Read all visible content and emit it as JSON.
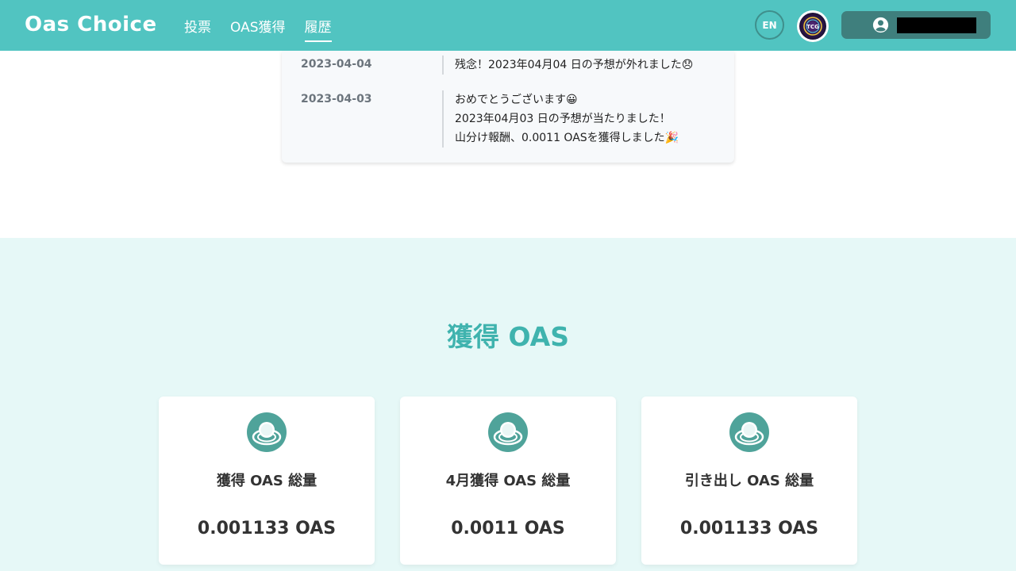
{
  "header": {
    "logo": "Oas Choice",
    "nav": [
      {
        "label": "投票"
      },
      {
        "label": "OAS獲得"
      },
      {
        "label": "履歴"
      }
    ],
    "lang": "EN",
    "avatar_text": "TCG"
  },
  "history": [
    {
      "date": "2023-04-04",
      "lines": [
        "残念！2023年04月04 日の予想が外れました😞"
      ]
    },
    {
      "date": "2023-04-03",
      "lines": [
        "おめでとうございます😀",
        "2023年04月03 日の予想が当たりました！",
        "山分け報酬、0.0011 OASを獲得しました🎉"
      ]
    }
  ],
  "earn": {
    "title": "獲得 OAS",
    "cards": [
      {
        "label": "獲得 OAS 総量",
        "value": "0.001133 OAS"
      },
      {
        "label": "4月獲得 OAS 総量",
        "value": "0.0011 OAS"
      },
      {
        "label": "引き出し OAS 総量",
        "value": "0.001133 OAS"
      }
    ]
  },
  "colors": {
    "header": "#51c4c1",
    "accent": "#3fb3ae",
    "section_bg": "#e6f8f7",
    "icon": "#4fa39a"
  }
}
